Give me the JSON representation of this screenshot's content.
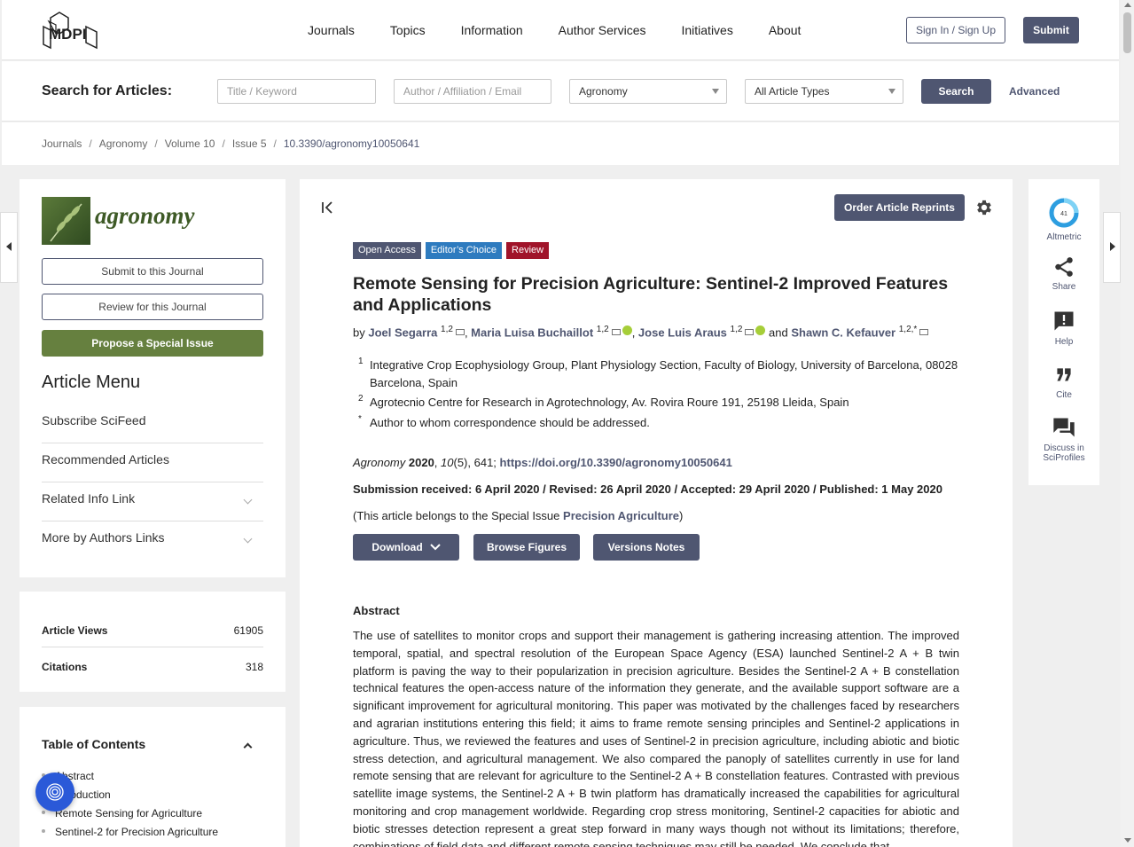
{
  "header": {
    "logo_text": "MDPI",
    "nav": [
      "Journals",
      "Topics",
      "Information",
      "Author Services",
      "Initiatives",
      "About"
    ],
    "signin": "Sign In / Sign Up",
    "submit": "Submit"
  },
  "search": {
    "label": "Search for Articles:",
    "title_placeholder": "Title / Keyword",
    "author_placeholder": "Author / Affiliation / Email",
    "journal_value": "Agronomy",
    "type_value": "All Article Types",
    "button": "Search",
    "advanced": "Advanced"
  },
  "breadcrumb": [
    "Journals",
    "Agronomy",
    "Volume 10",
    "Issue 5",
    "10.3390/agronomy10050641"
  ],
  "sidebar": {
    "journal_name": "agronomy",
    "submit_journal": "Submit to this Journal",
    "review_journal": "Review for this Journal",
    "propose": "Propose a Special Issue",
    "menu_title": "Article Menu",
    "menu_items": [
      "Subscribe SciFeed",
      "Recommended Articles",
      "Related Info Link",
      "More by Authors Links"
    ],
    "metrics": [
      {
        "label": "Article Views",
        "value": "61905"
      },
      {
        "label": "Citations",
        "value": "318"
      }
    ],
    "toc_title": "Table of Contents",
    "toc_items": [
      "Abstract",
      "Introduction",
      "Remote Sensing for Agriculture",
      "Sentinel-2 for Precision Agriculture"
    ]
  },
  "article": {
    "reprints": "Order Article Reprints",
    "badges": [
      {
        "label": "Open Access",
        "color": "#4f5671"
      },
      {
        "label": "Editor’s Choice",
        "color": "#2e7bbf"
      },
      {
        "label": "Review",
        "color": "#a0142a"
      }
    ],
    "title": "Remote Sensing for Precision Agriculture: Sentinel-2 Improved Features and Applications",
    "by": "by",
    "authors": [
      {
        "name": "Joel Segarra",
        "sup": "1,2"
      },
      {
        "name": "Maria Luisa Buchaillot",
        "sup": "1,2"
      },
      {
        "name": "Jose Luis Araus",
        "sup": "1,2"
      },
      {
        "name": "Shawn C. Kefauver",
        "sup": "1,2,*"
      }
    ],
    "and": "and",
    "affiliations": [
      {
        "num": "1",
        "text": "Integrative Crop Ecophysiology Group, Plant Physiology Section, Faculty of Biology, University of Barcelona, 08028 Barcelona, Spain"
      },
      {
        "num": "2",
        "text": "Agrotecnio Centre for Research in Agrotechnology, Av. Rovira Roure 191, 25198 Lleida, Spain"
      },
      {
        "num": "*",
        "text": "Author to whom correspondence should be addressed."
      }
    ],
    "citation": {
      "journal": "Agronomy",
      "year": "2020",
      "volume": "10",
      "rest": "(5), 641;",
      "doi": "https://doi.org/10.3390/agronomy10050641"
    },
    "dates": "Submission received: 6 April 2020 / Revised: 26 April 2020 / Accepted: 29 April 2020 / Published: 1 May 2020",
    "special_prefix": "(This article belongs to the Special Issue",
    "special_name": "Precision Agriculture",
    "special_suffix": ")",
    "download": "Download",
    "browse": "Browse Figures",
    "versions": "Versions Notes",
    "abstract_heading": "Abstract",
    "abstract": "The use of satellites to monitor crops and support their management is gathering increasing attention. The improved temporal, spatial, and spectral resolution of the European Space Agency (ESA) launched Sentinel-2 A + B twin platform is paving the way to their popularization in precision agriculture. Besides the Sentinel-2 A + B constellation technical features the open-access nature of the information they generate, and the available support software are a significant improvement for agricultural monitoring. This paper was motivated by the challenges faced by researchers and agrarian institutions entering this field; it aims to frame remote sensing principles and Sentinel-2 applications in agriculture. Thus, we reviewed the features and uses of Sentinel-2 in precision agriculture, including abiotic and biotic stress detection, and agricultural management. We also compared the panoply of satellites currently in use for land remote sensing that are relevant for agriculture to the Sentinel-2 A + B constellation features. Contrasted with previous satellite image systems, the Sentinel-2 A + B twin platform has dramatically increased the capabilities for agricultural monitoring and crop management worldwide. Regarding crop stress monitoring, Sentinel-2 capacities for abiotic and biotic stresses detection represent a great step forward in many ways though not without its limitations; therefore, combinations of field data and different remote sensing techniques may still be needed. We conclude that"
  },
  "rail": {
    "altmetric_score": "41",
    "items": [
      "Altmetric",
      "Share",
      "Help",
      "Cite",
      "Discuss in SciProfiles"
    ]
  }
}
